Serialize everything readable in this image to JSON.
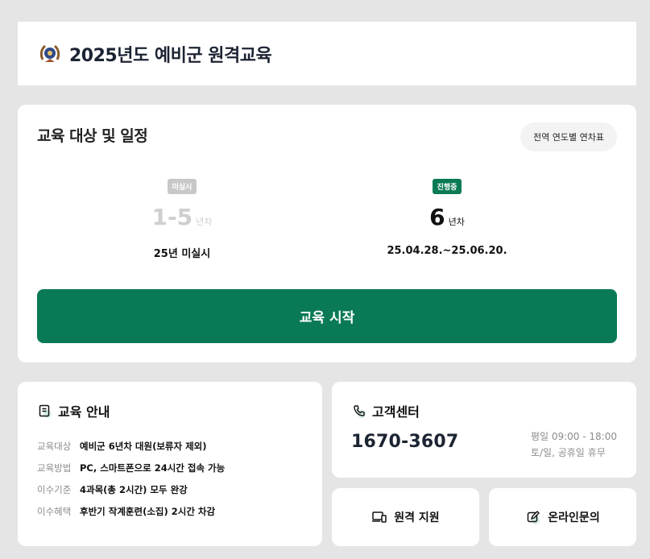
{
  "header": {
    "title": "2025년도 예비군 원격교육",
    "emblem_icon": "army-emblem-icon"
  },
  "schedule": {
    "title": "교육 대상 및 일정",
    "table_button": "전역 연도별 연차표",
    "left": {
      "badge": "미실시",
      "round": "1-5",
      "unit": "년차",
      "period": "25년 미실시"
    },
    "right": {
      "badge": "진행중",
      "round": "6",
      "unit": "년차",
      "period": "25.04.28.~25.06.20."
    },
    "start_button": "교육 시작"
  },
  "guide": {
    "title": "교육 안내",
    "icon": "document-icon",
    "rows": [
      {
        "key": "교육대상",
        "value": "예비군 6년차 대원(보류자 제외)"
      },
      {
        "key": "교육방법",
        "value": "PC, 스마트폰으로 24시간 접속 가능"
      },
      {
        "key": "이수기준",
        "value": "4과목(총 2시간) 모두 완강"
      },
      {
        "key": "이수혜택",
        "value": "후반기 작계훈련(소집) 2시간 차감"
      }
    ]
  },
  "customer_center": {
    "title": "고객센터",
    "icon": "phone-icon",
    "phone": "1670-3607",
    "hours_weekday": "평일 09:00 - 18:00",
    "hours_weekend": "토/일, 공휴일 휴무"
  },
  "remote_support": {
    "label": "원격 지원",
    "icon": "devices-icon"
  },
  "online_inquiry": {
    "label": "온라인문의",
    "icon": "edit-icon"
  },
  "colors": {
    "accent": "#0a7a56",
    "background": "#e5e5e5",
    "inactive": "#c8c8c8"
  }
}
